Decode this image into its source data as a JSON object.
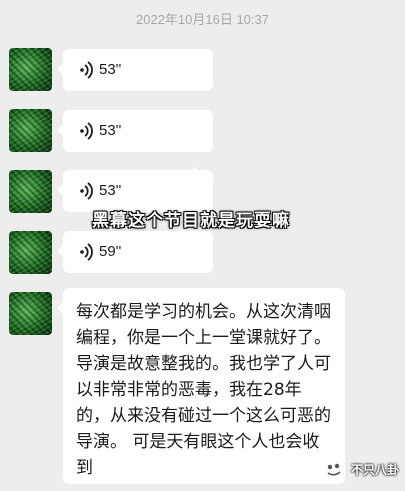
{
  "header": {
    "timestamp": "2022年10月16日 10:37"
  },
  "messages": [
    {
      "type": "voice",
      "duration": "53''"
    },
    {
      "type": "voice",
      "duration": "53''"
    },
    {
      "type": "voice",
      "duration": "53''"
    },
    {
      "type": "voice",
      "duration": "59''"
    },
    {
      "type": "text",
      "text": "每次都是学习的机会。从这次清咽编程，你是一个上一堂课就好了。 导演是故意整我的。我也学了人可以非常非常的恶毒，我在28年的，从来没有碰过一个这么可恶的导演。 可是天有眼这个人也会收到"
    }
  ],
  "overlay": {
    "subtitle": "黑幕这个节目就是玩耍嘛",
    "play_icon": "play-icon"
  },
  "watermark": {
    "text": "不只八卦",
    "icon": "watermark-logo-icon"
  },
  "colors": {
    "background": "#ededed",
    "bubble": "#ffffff",
    "avatar": "#2e7d32"
  }
}
